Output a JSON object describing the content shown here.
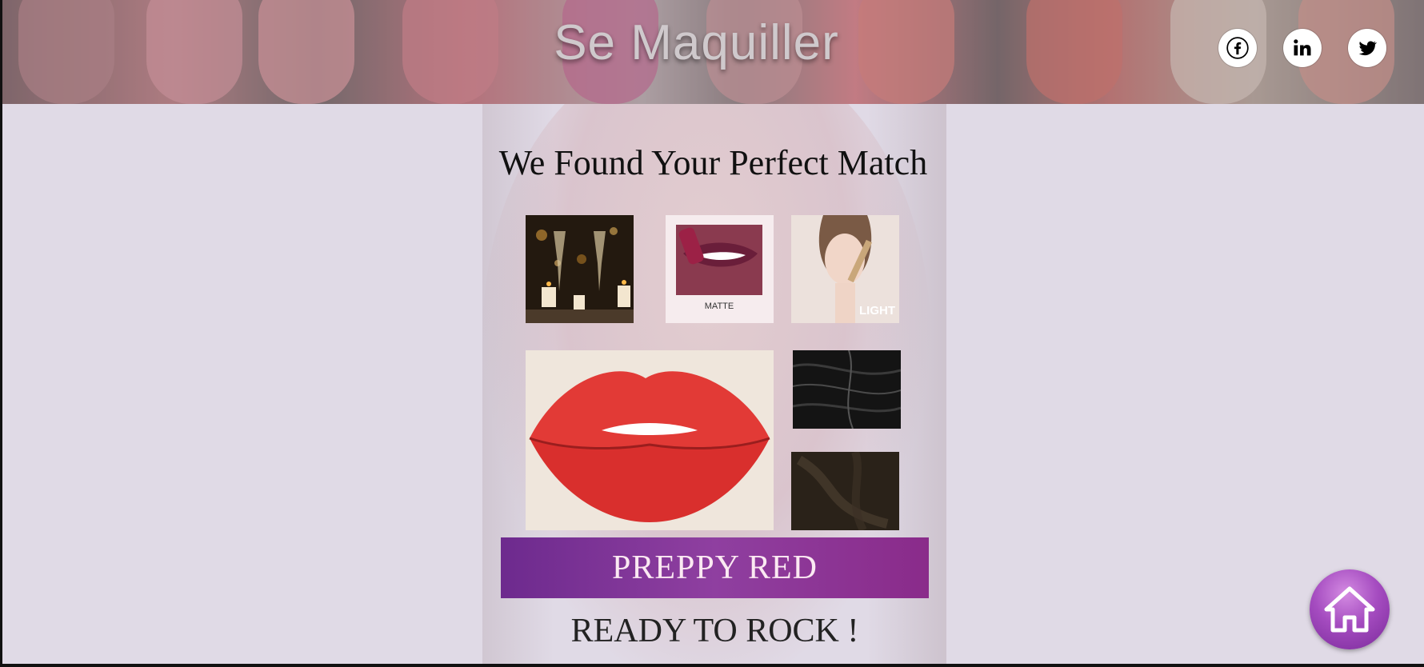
{
  "header": {
    "site_title": "Se Maquiller",
    "social": [
      {
        "icon": "facebook-icon",
        "glyph": "f"
      },
      {
        "icon": "linkedin-icon",
        "glyph": "in"
      },
      {
        "icon": "twitter-icon",
        "glyph": "twitter"
      }
    ]
  },
  "main": {
    "title": "We Found Your Perfect Match",
    "images": [
      {
        "name": "occasion-image",
        "desc": "champagne-candles"
      },
      {
        "name": "finish-image",
        "label": "MATTE"
      },
      {
        "name": "skin-tone-image",
        "label": "LIGHT"
      },
      {
        "name": "lipstick-swatch-image",
        "desc": "red-lips"
      },
      {
        "name": "hair-color-image",
        "desc": "black-hair"
      },
      {
        "name": "eye-color-image",
        "desc": "dark-brown"
      }
    ],
    "result_name": "PREPPY RED",
    "tagline": "READY TO ROCK !"
  },
  "colors": {
    "accent_purple": "#7a2f97",
    "background": "#e0dae6"
  },
  "home_button": {
    "icon": "home-icon"
  }
}
